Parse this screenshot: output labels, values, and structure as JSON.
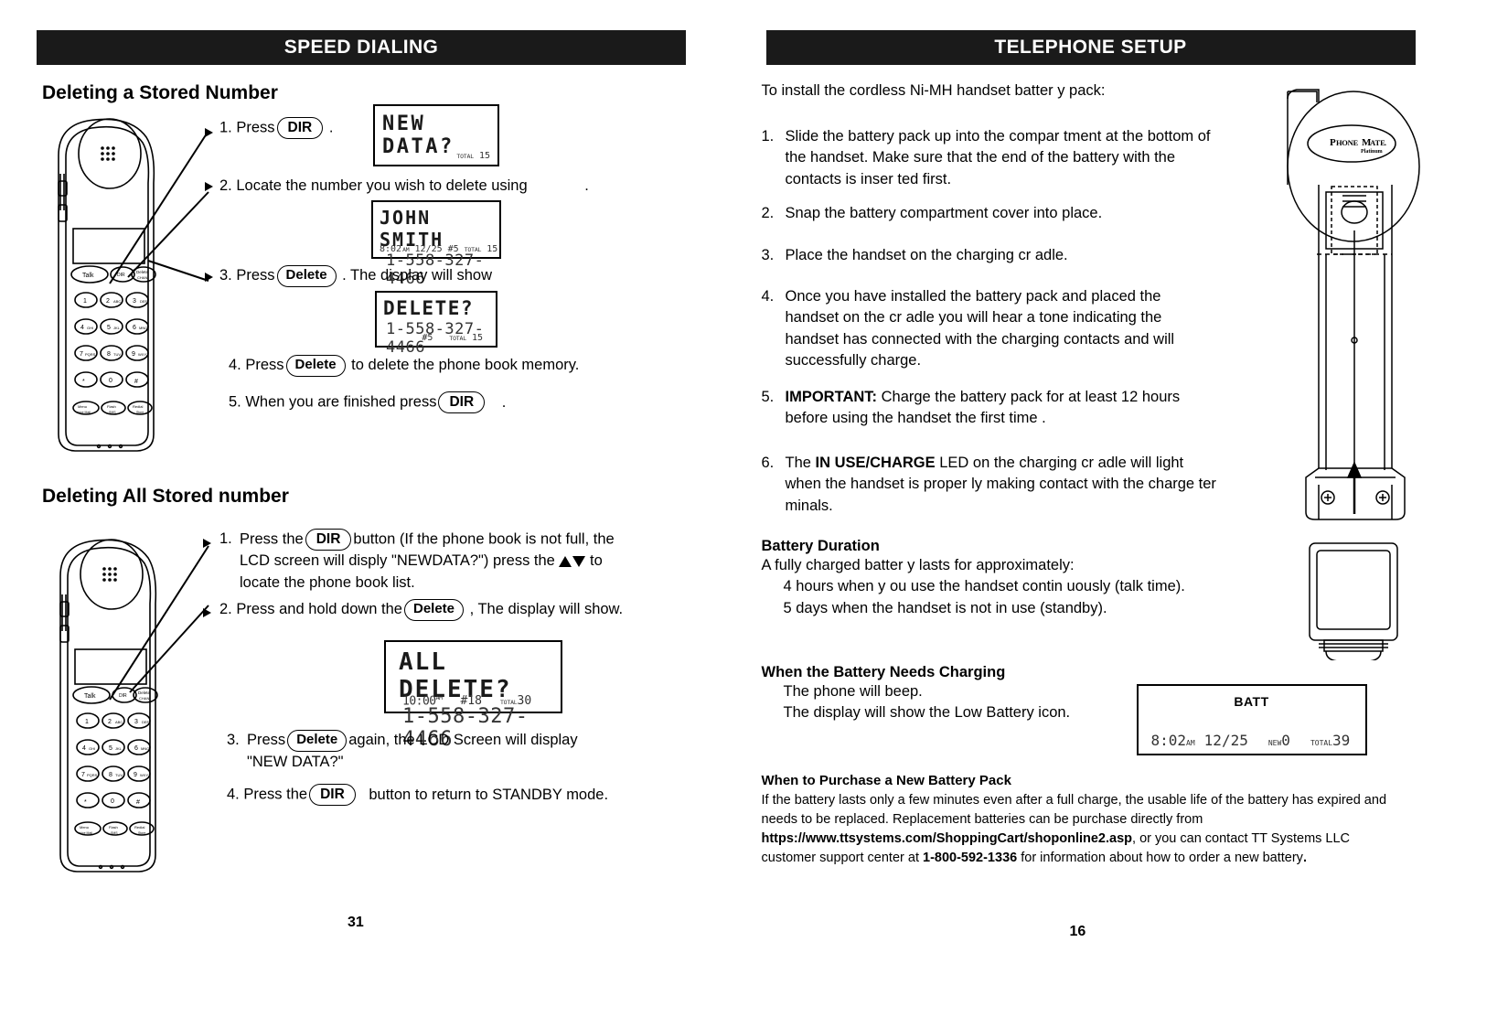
{
  "left_page": {
    "banner": "SPEED DIALING",
    "page_number": "31",
    "section1": {
      "heading": "Deleting a Stored Number",
      "steps": [
        {
          "num": "1.",
          "pre": "Press",
          "key": "DIR",
          "post": "."
        },
        {
          "num": "2.",
          "pre": "Locate the number you wish to delete using",
          "key": "",
          "post": "."
        },
        {
          "num": "3.",
          "pre": "Press",
          "key": "Delete",
          "post": ". The display will show"
        },
        {
          "num": "4.",
          "pre": "Press",
          "key": "Delete",
          "post": "to delete the phone book memory."
        },
        {
          "num": "5.",
          "pre": "When you are finished press",
          "key": "DIR",
          "post": "."
        }
      ],
      "lcd1": {
        "line1": "NEW DATA?",
        "line2": "",
        "status_total_label": "TOTAL",
        "status_total": "15"
      },
      "lcd2": {
        "line1": "JOHN SMITH",
        "line2": "1-558-327-4466",
        "time": "8:02",
        "ampm": "AM",
        "date": "12/25",
        "mem": "#5",
        "status_total_label": "TOTAL",
        "status_total": "15"
      },
      "lcd3": {
        "line1": "DELETE?",
        "line2": "1-558-327-4466",
        "mem": "#5",
        "status_total_label": "TOTAL",
        "status_total": "15"
      }
    },
    "section2": {
      "heading": "Deleting All Stored number",
      "step1_a": "Press the",
      "step1_key": "DIR",
      "step1_b": "button (If the phone book  is not full, the",
      "step1_c": "LCD  screen will disply \"NEWDATA?\")  press the",
      "step1_d": "to",
      "step1_e": "locate the phone book list.",
      "step2_a": "Press and hold down the",
      "step2_key": "Delete",
      "step2_b": ", The display will show.",
      "step3_a": "Press",
      "step3_key": "Delete",
      "step3_b": "again,  the LCD Screen will display",
      "step3_c": "\"NEW DATA?\"",
      "step4_a": "Press the",
      "step4_key": "DIR",
      "step4_b": "button to return to STANDBY mode.",
      "lcd4": {
        "line1": "ALL DELETE?",
        "line2": "1-558-327-4466",
        "time": "10:00",
        "ampm": "AM",
        "mem": "#18",
        "status_total_label": "TOTAL",
        "status_total": "30"
      }
    }
  },
  "right_page": {
    "banner": "TELEPHONE SETUP",
    "page_number": "16",
    "intro": "To install the cordless Ni-MH handset batter y pack:",
    "steps": [
      {
        "num": "1.",
        "text": "Slide the battery pack up into the compar tment at the bottom of the handset.  Make sure that the end of the battery with the contacts is inser ted first.",
        "bold_prefix": ""
      },
      {
        "num": "2.",
        "text": "Snap the battery compartment cover into place.",
        "bold_prefix": ""
      },
      {
        "num": "3.",
        "text": "Place the handset on the charging cr adle.",
        "bold_prefix": ""
      },
      {
        "num": "4.",
        "text": "Once you have installed the battery pack and placed the handset on the cr adle you will hear a tone indicating the handset has connected with the charging contacts and will successfully charge.",
        "bold_prefix": ""
      },
      {
        "num": "5.",
        "text": "Charge the battery pack for at least 12 hours before using the handset the first time .",
        "bold_prefix": "IMPORTANT:"
      },
      {
        "num": "6.",
        "text": "LED on the charging cr adle will light when the handset is proper ly making contact with the charge ter minals.",
        "bold_prefix": "IN USE/CHARGE",
        "pre_bold": "The "
      }
    ],
    "battery_duration": {
      "heading": "Battery Duration",
      "line1": "A fully charged batter y lasts for approximately:",
      "line2": "4 hours when y ou use the handset contin uously (talk time).",
      "line3": "5 days when the handset is not in use (standby)."
    },
    "needs_charging": {
      "heading": "When the Battery Needs Charging",
      "line1": "The phone will beep.",
      "line2": "The display will show the Low Battery icon."
    },
    "purchase": {
      "heading": "When to Purchase a New Battery Pack",
      "para_a": "If the battery lasts only a few minutes even after a full charge, the usable life of the battery has expired and needs to be replaced. Replacement batteries can be purchase directly from ",
      "url": "https://www.ttsystems.com/ShoppingCart/shoponline2.asp",
      "para_b": ", or you can contact TT Systems LLC customer support center at ",
      "phone": "1-800-592-1336",
      "para_c": " for information about how to order a new battery",
      "para_d": "."
    },
    "batt_lcd": {
      "label": "BATT",
      "time": "8:02",
      "ampm": "AM",
      "date": "12/25",
      "new_label": "NEW",
      "new_value": "0",
      "total_label": "TOTAL",
      "total_value": "39"
    },
    "cradle_logo": {
      "brand": "PHONEMATE",
      "sub": "Platinum"
    }
  },
  "colors": {
    "banner_bg": "#1a1a1a",
    "banner_fg": "#ffffff",
    "ink": "#000000",
    "paper": "#ffffff"
  }
}
